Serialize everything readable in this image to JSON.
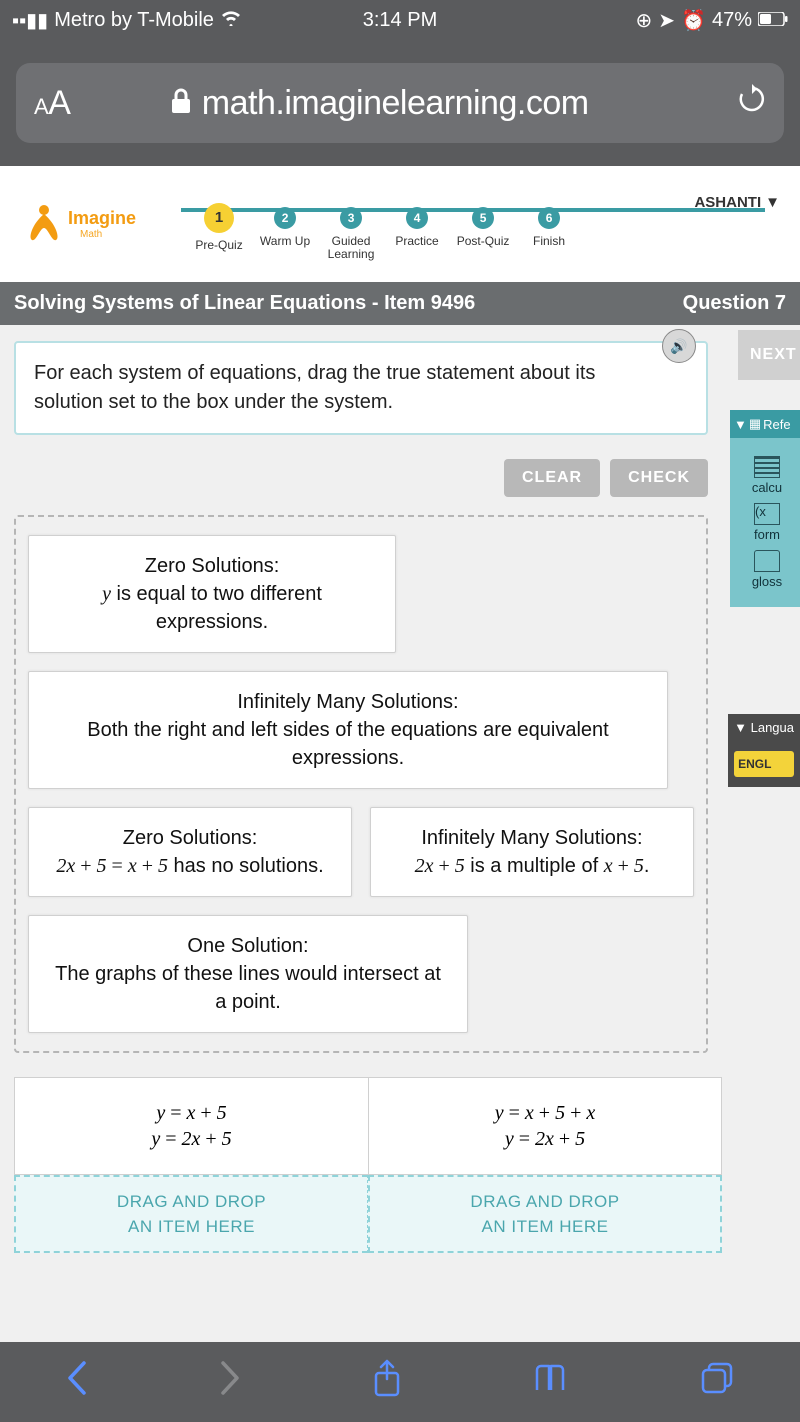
{
  "status": {
    "carrier": "Metro by T-Mobile",
    "time": "3:14 PM",
    "battery": "47%"
  },
  "browser": {
    "url": "math.imaginelearning.com"
  },
  "logo": {
    "line1": "Imagine",
    "line2": "Math"
  },
  "steps": [
    {
      "num": "1",
      "label": "Pre-Quiz",
      "active": true
    },
    {
      "num": "2",
      "label": "Warm Up"
    },
    {
      "num": "3",
      "label": "Guided Learning"
    },
    {
      "num": "4",
      "label": "Practice"
    },
    {
      "num": "5",
      "label": "Post-Quiz"
    },
    {
      "num": "6",
      "label": "Finish"
    }
  ],
  "user": "ASHANTI",
  "topic_bar": {
    "left": "Solving Systems of Linear Equations - Item 9496",
    "right": "Question 7"
  },
  "prompt": "For each system of equations, drag the true statement about its solution set to the box under the system.",
  "buttons": {
    "clear": "CLEAR",
    "check": "CHECK",
    "next": "NEXT"
  },
  "cards": {
    "c1": {
      "title": "Zero Solutions:",
      "body_pre": "y",
      "body_post": " is equal to two different expressions."
    },
    "c2": {
      "title": "Infinitely Many Solutions:",
      "body": "Both the right and left sides of the equations are equivalent expressions."
    },
    "c3": {
      "title": "Zero Solutions:",
      "eq": "2x + 5 = x + 5",
      "body": " has no solutions."
    },
    "c4": {
      "title": "Infinitely Many Solutions:",
      "eq": "2x + 5",
      "body_mid": " is a multiple of ",
      "eq2": "x + 5",
      "body_end": "."
    },
    "c5": {
      "title": "One Solution:",
      "body": "The graphs of these lines would intersect at a point."
    }
  },
  "targets": {
    "t1": {
      "eq1": "y = x + 5",
      "eq2": "y = 2x + 5"
    },
    "t2": {
      "eq1": "y = x + 5 + x",
      "eq2": "y = 2x + 5"
    },
    "drop1": "DRAG AND DROP",
    "drop2": "AN ITEM HERE"
  },
  "ref": {
    "header": "Refe",
    "i1": "calcu",
    "i2": "form",
    "i3": "gloss"
  },
  "lang": {
    "header": "Langua",
    "btn": "ENGL"
  }
}
